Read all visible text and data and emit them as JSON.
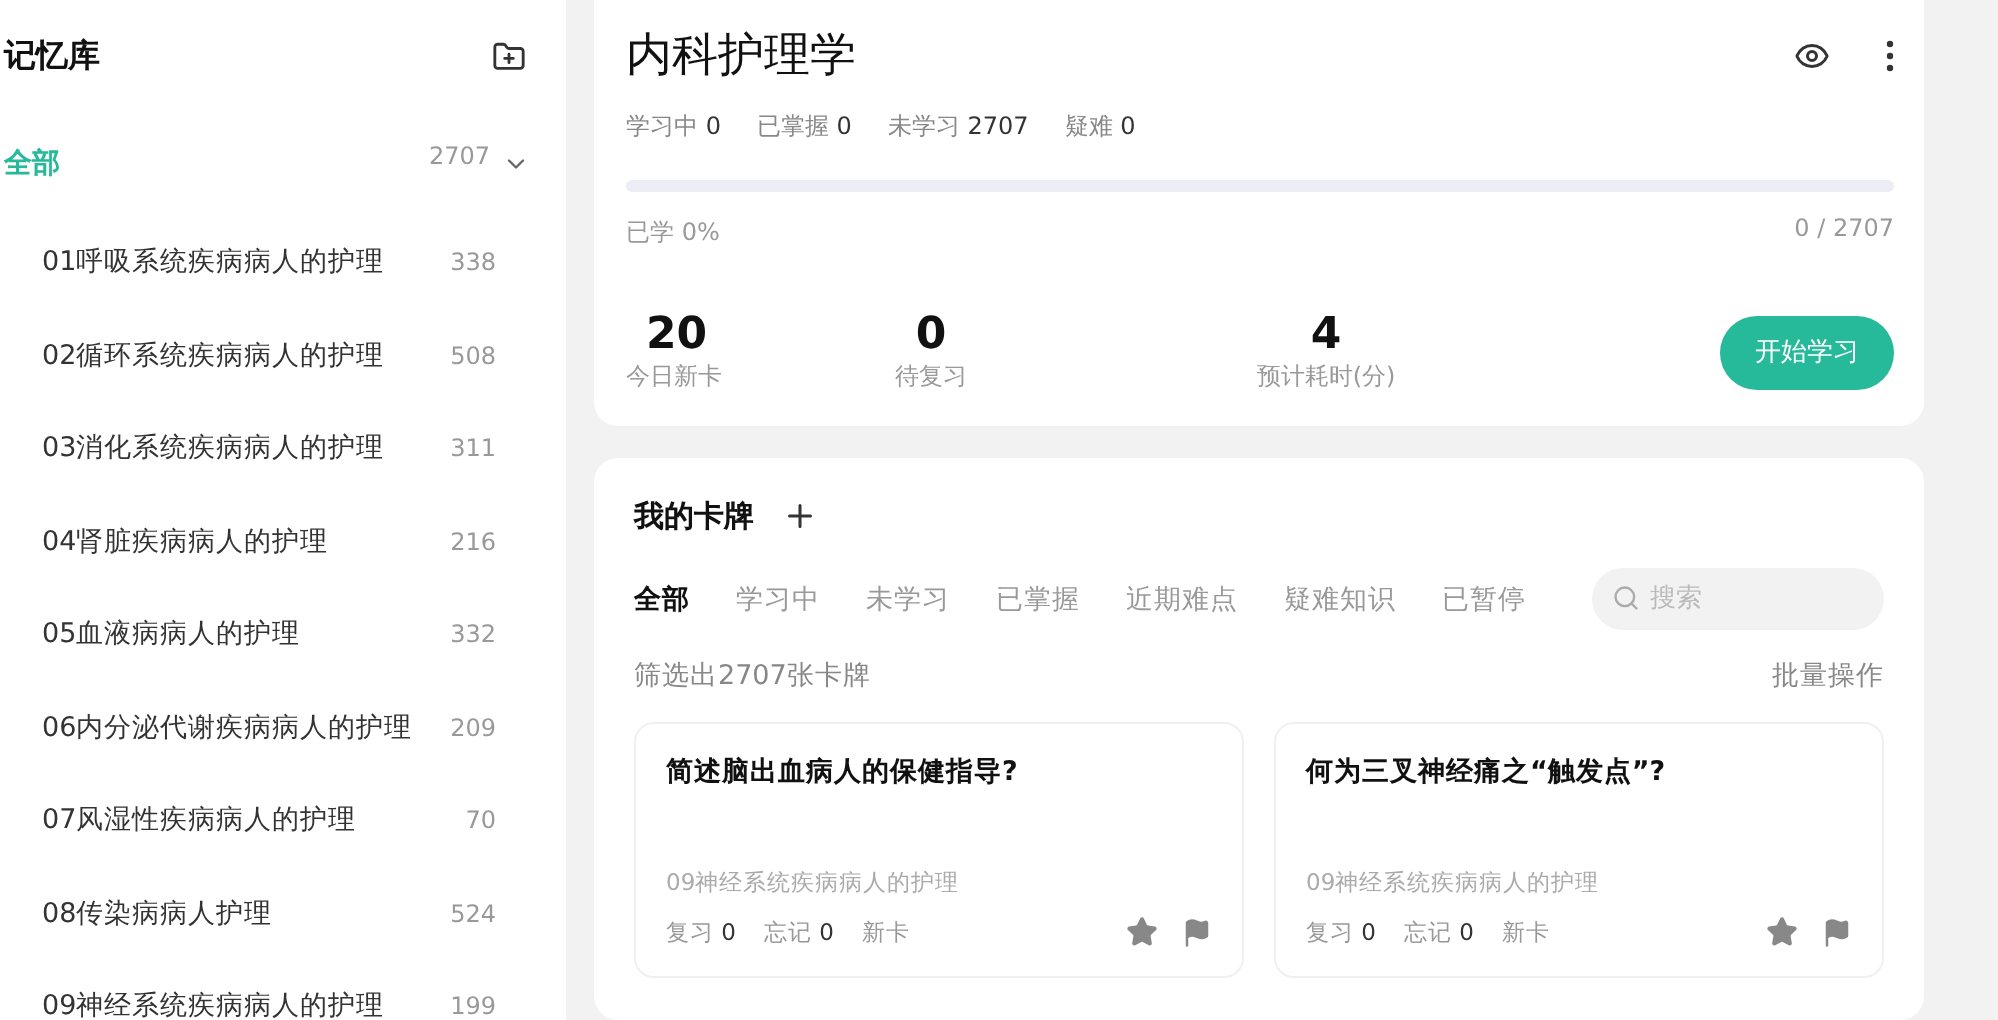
{
  "sidebar": {
    "title": "记忆库",
    "all": {
      "label": "全部",
      "count": "2707",
      "selected": true,
      "expanded": true
    },
    "items": [
      {
        "label": "01呼吸系统疾病病人的护理",
        "count": "338"
      },
      {
        "label": "02循环系统疾病病人的护理",
        "count": "508"
      },
      {
        "label": "03消化系统疾病病人的护理",
        "count": "311"
      },
      {
        "label": "04肾脏疾病病人的护理",
        "count": "216"
      },
      {
        "label": "05血液病病人的护理",
        "count": "332"
      },
      {
        "label": "06内分泌代谢疾病病人的护理",
        "count": "209"
      },
      {
        "label": "07风湿性疾病病人的护理",
        "count": "70"
      },
      {
        "label": "08传染病病人护理",
        "count": "524"
      },
      {
        "label": "09神经系统疾病病人的护理",
        "count": "199"
      }
    ]
  },
  "deck": {
    "title": "内科护理学",
    "stats": [
      {
        "label": "学习中",
        "value": "0"
      },
      {
        "label": "已掌握",
        "value": "0"
      },
      {
        "label": "未学习",
        "value": "2707"
      },
      {
        "label": "疑难",
        "value": "0"
      }
    ],
    "progress": {
      "level": 0,
      "label": "已学 0%",
      "reading": "0 / 2707"
    },
    "summary": [
      {
        "value": "20",
        "label": "今日新卡"
      },
      {
        "value": "0",
        "label": "待复习"
      },
      {
        "value": "4",
        "label": "预计耗时(分)"
      }
    ],
    "start_button": "开始学习"
  },
  "cards": {
    "title": "我的卡牌",
    "filters": [
      {
        "label": "全部",
        "selected": true
      },
      {
        "label": "学习中",
        "selected": false
      },
      {
        "label": "未学习",
        "selected": false
      },
      {
        "label": "已掌握",
        "selected": false
      },
      {
        "label": "近期难点",
        "selected": false
      },
      {
        "label": "疑难知识",
        "selected": false
      },
      {
        "label": "已暂停",
        "selected": false
      }
    ],
    "search": {
      "placeholder": "搜索"
    },
    "count_text": "筛选出2707张卡牌",
    "batch_button": "批量操作",
    "items": [
      {
        "question": "简述脑出血病人的保健指导?",
        "chapter": "09神经系统疾病病人的护理",
        "review": "复习",
        "review_count": "0",
        "forget": "忘记",
        "forget_count": "0",
        "status": "新卡",
        "starred": false,
        "flagged": false
      },
      {
        "question": "何为三叉神经痛之“触发点”?",
        "chapter": "09神经系统疾病病人的护理",
        "review": "复习",
        "review_count": "0",
        "forget": "忘记",
        "forget_count": "0",
        "status": "新卡",
        "starred": false,
        "flagged": false
      }
    ]
  }
}
